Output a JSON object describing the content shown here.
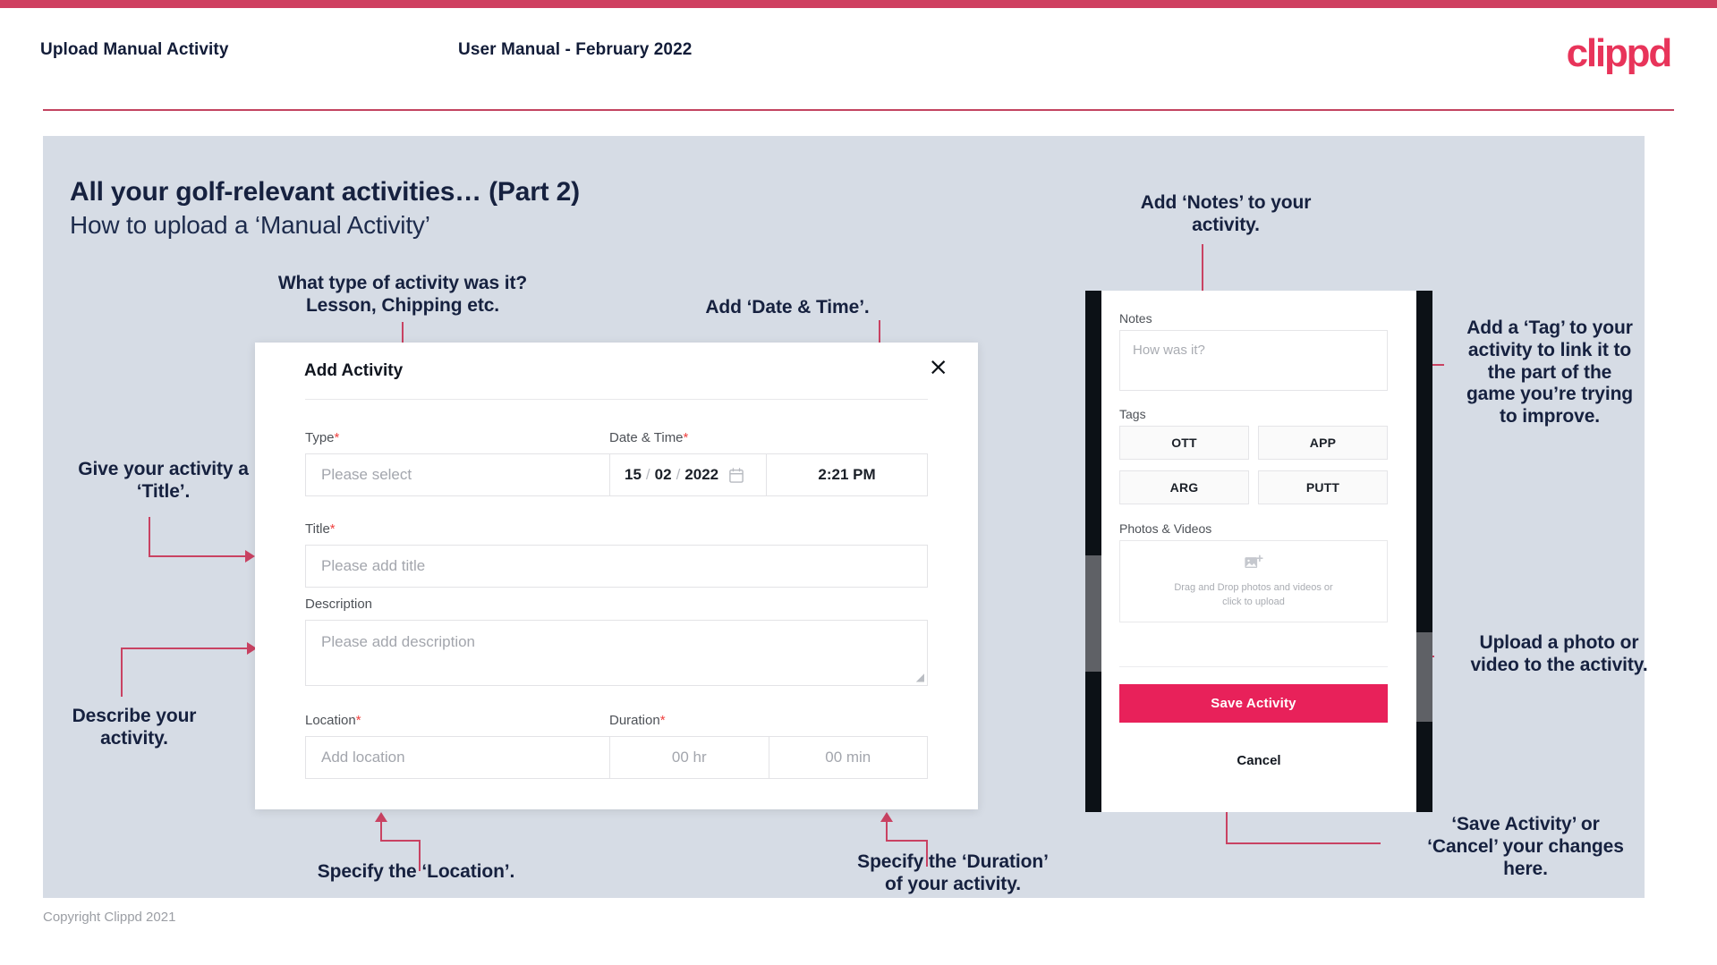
{
  "header": {
    "title": "Upload Manual Activity",
    "subtitle": "User Manual - February 2022",
    "logo": "clippd"
  },
  "slide": {
    "title": "All your golf-relevant activities… (Part 2)",
    "subtitle": "How to upload a ‘Manual Activity’"
  },
  "dialog": {
    "title": "Add Activity",
    "close_icon": "×",
    "type": {
      "label": "Type",
      "required": "*",
      "placeholder": "Please select",
      "chevron_icon": "chevron-down"
    },
    "datetime": {
      "label": "Date & Time",
      "required": "*",
      "day": "15",
      "month": "02",
      "year": "2022",
      "separator": "/",
      "time": "2:21 PM",
      "calendar_icon": "calendar"
    },
    "title_field": {
      "label": "Title",
      "required": "*",
      "placeholder": "Please add title"
    },
    "description": {
      "label": "Description",
      "required": "",
      "placeholder": "Please add description"
    },
    "location": {
      "label": "Location",
      "required": "*",
      "placeholder": "Add location"
    },
    "duration": {
      "label": "Duration",
      "required": "*",
      "hours_placeholder": "00 hr",
      "minutes_placeholder": "00 min"
    }
  },
  "phone": {
    "notes": {
      "label": "Notes",
      "placeholder": "How was it?"
    },
    "tags": {
      "label": "Tags",
      "items": [
        "OTT",
        "APP",
        "ARG",
        "PUTT"
      ]
    },
    "photos": {
      "label": "Photos & Videos",
      "upload_icon": "add-image-icon",
      "line1": "Drag and Drop photos and videos or",
      "line2": "click to upload"
    },
    "save_label": "Save Activity",
    "cancel_label": "Cancel"
  },
  "annotations": {
    "type": "What type of activity was it?\nLesson, Chipping etc.",
    "datetime": "Add ‘Date & Time’.",
    "title": "Give your activity a\n‘Title’.",
    "description": "Describe your\nactivity.",
    "location": "Specify the ‘Location’.",
    "duration": "Specify the ‘Duration’\nof your activity.",
    "notes": "Add ‘Notes’ to your\nactivity.",
    "tags": "Add a ‘Tag’ to your\nactivity to link it to\nthe part of the\ngame you’re trying\nto improve.",
    "upload": "Upload a photo or\nvideo to the activity.",
    "save": "‘Save Activity’ or\n‘Cancel’ your changes\nhere."
  },
  "footer": {
    "copyright": "Copyright Clippd 2021"
  },
  "colors": {
    "accent": "#e8215a",
    "top_bar": "#cf4060",
    "annotation_line": "#c94262",
    "slide_bg": "#d6dce5",
    "text_dark": "#16213f"
  }
}
